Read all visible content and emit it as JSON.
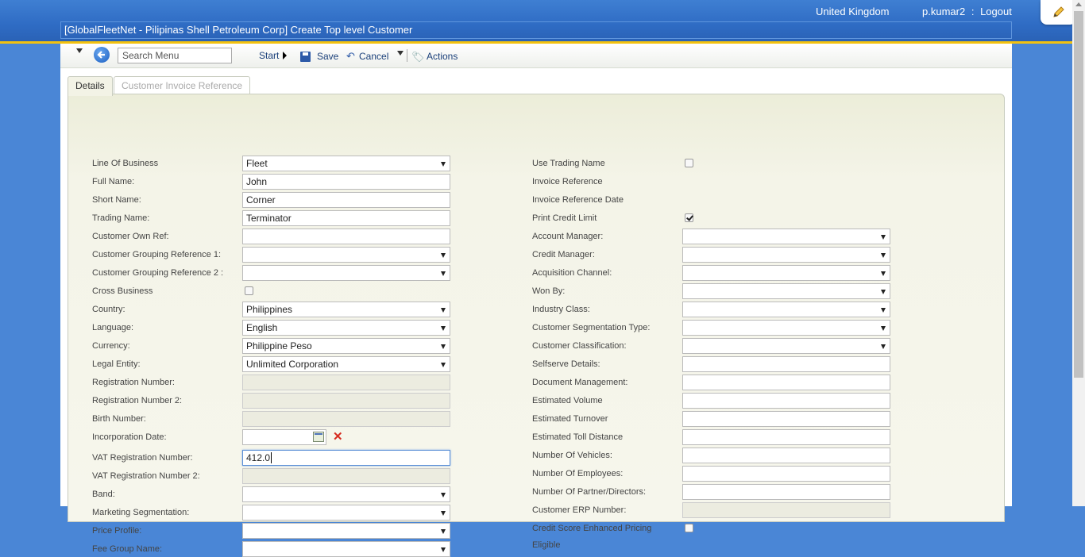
{
  "header": {
    "region": "United Kingdom",
    "user": "p.kumar2",
    "separator": ":",
    "logout": "Logout",
    "title": "[GlobalFleetNet - Pilipinas Shell Petroleum Corp] Create Top level Customer"
  },
  "toolbar": {
    "search_placeholder": "Search Menu",
    "start_label": "Start",
    "save_label": "Save",
    "cancel_label": "Cancel",
    "actions_label": "Actions"
  },
  "tabs": [
    {
      "label": "Details",
      "active": true
    },
    {
      "label": "Customer Invoice Reference",
      "active": false
    }
  ],
  "left_fields": [
    {
      "label": "Line Of Business",
      "type": "select",
      "value": "Fleet"
    },
    {
      "label": "Full Name:",
      "type": "text",
      "value": "John"
    },
    {
      "label": "Short Name:",
      "type": "text",
      "value": "Corner"
    },
    {
      "label": "Trading Name:",
      "type": "text",
      "value": "Terminator"
    },
    {
      "label": "Customer Own Ref:",
      "type": "text",
      "value": ""
    },
    {
      "label": "Customer Grouping Reference 1:",
      "type": "select",
      "value": ""
    },
    {
      "label": "Customer Grouping Reference 2 :",
      "type": "select",
      "value": ""
    },
    {
      "label": "Cross Business",
      "type": "checkbox",
      "checked": false
    },
    {
      "label": "Country:",
      "type": "select",
      "value": "Philippines"
    },
    {
      "label": "Language:",
      "type": "select",
      "value": "English"
    },
    {
      "label": "Currency:",
      "type": "select",
      "value": "Philippine Peso"
    },
    {
      "label": "Legal Entity:",
      "type": "select",
      "value": "Unlimited Corporation"
    },
    {
      "label": "Registration Number:",
      "type": "disabled",
      "value": ""
    },
    {
      "label": "Registration Number 2:",
      "type": "disabled",
      "value": ""
    },
    {
      "label": "Birth Number:",
      "type": "disabled",
      "value": ""
    },
    {
      "label": "Incorporation Date:",
      "type": "date",
      "value": ""
    },
    {
      "label": "VAT Registration Number:",
      "type": "text",
      "value": "412.0",
      "focused": true
    },
    {
      "label": "VAT Registration Number 2:",
      "type": "disabled",
      "value": ""
    },
    {
      "label": "Band:",
      "type": "select",
      "value": ""
    },
    {
      "label": "Marketing Segmentation:",
      "type": "select",
      "value": ""
    },
    {
      "label": "Price Profile:",
      "type": "select",
      "value": ""
    },
    {
      "label": "Fee Group Name:",
      "type": "select",
      "value": ""
    }
  ],
  "right_fields": [
    {
      "label": "Use Trading Name",
      "type": "checkbox",
      "checked": false
    },
    {
      "label": "Invoice Reference",
      "type": "none"
    },
    {
      "label": "Invoice Reference Date",
      "type": "none"
    },
    {
      "label": "Print Credit Limit",
      "type": "checkbox",
      "checked": true
    },
    {
      "label": "Account Manager:",
      "type": "select",
      "value": ""
    },
    {
      "label": "Credit Manager:",
      "type": "select",
      "value": ""
    },
    {
      "label": "Acquisition Channel:",
      "type": "select",
      "value": ""
    },
    {
      "label": "Won By:",
      "type": "select",
      "value": ""
    },
    {
      "label": "Industry Class:",
      "type": "select",
      "value": ""
    },
    {
      "label": "Customer Segmentation Type:",
      "type": "select",
      "value": ""
    },
    {
      "label": "Customer Classification:",
      "type": "select",
      "value": ""
    },
    {
      "label": "Selfserve Details:",
      "type": "text",
      "value": ""
    },
    {
      "label": "Document Management:",
      "type": "text",
      "value": ""
    },
    {
      "label": "Estimated Volume",
      "type": "text",
      "value": ""
    },
    {
      "label": "Estimated Turnover",
      "type": "text",
      "value": ""
    },
    {
      "label": "Estimated Toll Distance",
      "type": "text",
      "value": ""
    },
    {
      "label": "Number Of Vehicles:",
      "type": "text",
      "value": ""
    },
    {
      "label": "Number Of Employees:",
      "type": "text",
      "value": ""
    },
    {
      "label": "Number Of Partner/Directors:",
      "type": "text",
      "value": ""
    },
    {
      "label": "Customer ERP Number:",
      "type": "disabled",
      "value": ""
    },
    {
      "label": "Credit Score Enhanced Pricing",
      "type": "checkbox",
      "checked": false
    },
    {
      "label": "Eligible",
      "type": "none"
    }
  ]
}
